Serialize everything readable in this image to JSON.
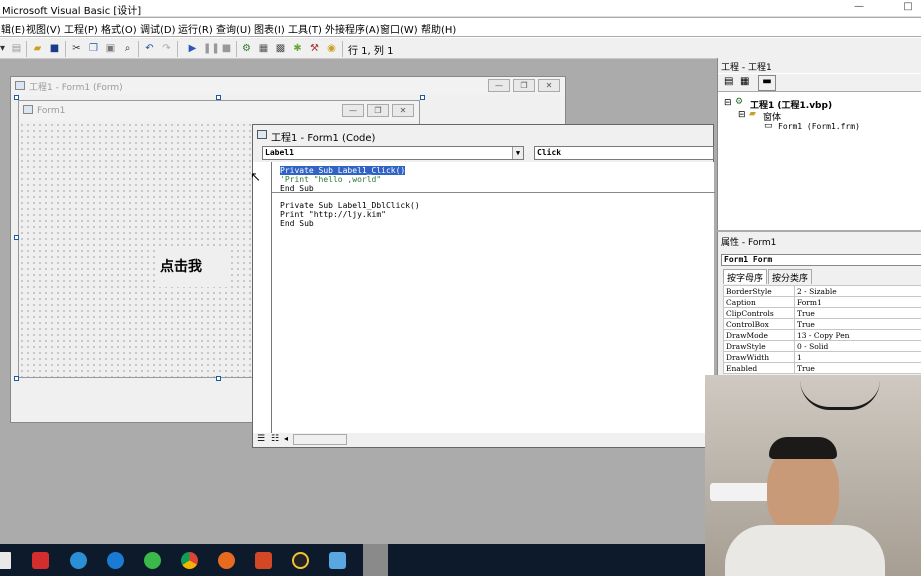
{
  "app": {
    "title": "Microsoft Visual Basic [设计]"
  },
  "window_buttons": [
    "—",
    "□"
  ],
  "menu": [
    "辑(E)",
    "视图(V)",
    "工程(P)",
    "格式(O)",
    "调试(D)",
    "运行(R)",
    "查询(U)",
    "图表(I)",
    "工具(T)",
    "外接程序(A)",
    "窗口(W)",
    "帮助(H)"
  ],
  "toolbar": {
    "position_text": "行 1, 列 1"
  },
  "project_designer": {
    "title": "工程1 - Form1 (Form)",
    "form_title": "Form1",
    "label_caption": "点击我"
  },
  "code_window": {
    "title": "工程1 - Form1 (Code)",
    "object": "Label1",
    "procedure": "Click",
    "lines": [
      "Private Sub Label1_Click()",
      "'Print \"hello ,world\"",
      "End Sub",
      "Private Sub Label1_DblClick()",
      "Print \"http://ljy.kim\"",
      "End Sub"
    ]
  },
  "project_explorer": {
    "title": "工程 - 工程1",
    "root": "工程1 (工程1.vbp)",
    "folder": "窗体",
    "file": "Form1 (Form1.frm)"
  },
  "properties": {
    "title": "属性 - Form1",
    "object": "Form1 Form",
    "tabs": [
      "按字母序",
      "按分类序"
    ],
    "rows": [
      [
        "BorderStyle",
        "2 - Sizable"
      ],
      [
        "Caption",
        "Form1"
      ],
      [
        "ClipControls",
        "True"
      ],
      [
        "ControlBox",
        "True"
      ],
      [
        "DrawMode",
        "13 - Copy Pen"
      ],
      [
        "DrawStyle",
        "0 - Solid"
      ],
      [
        "DrawWidth",
        "1"
      ],
      [
        "Enabled",
        "True"
      ]
    ]
  },
  "taskbar": {
    "apps": [
      "youdao-icon",
      "ie-icon",
      "edge-icon",
      "360-icon",
      "chrome-icon",
      "firefox-icon",
      "powerpoint-icon",
      "qq-icon",
      "remote-desktop-icon",
      "vb-icon"
    ]
  }
}
